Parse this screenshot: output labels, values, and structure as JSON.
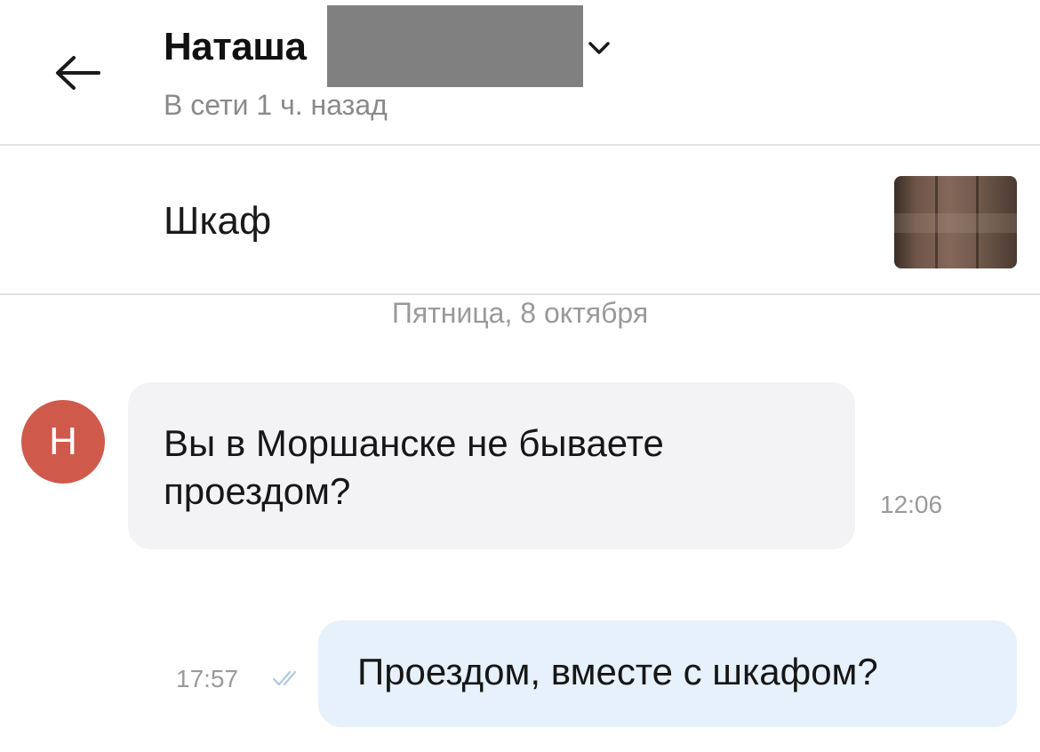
{
  "header": {
    "contact_name": "Наташа",
    "status": "В сети 1 ч. назад"
  },
  "listing": {
    "title": "Шкаф"
  },
  "chat": {
    "date_separator": "Пятница, 8 октября",
    "messages": [
      {
        "direction": "incoming",
        "avatar_letter": "Н",
        "text": "Вы в Моршанске не бываете проездом?",
        "time": "12:06"
      },
      {
        "direction": "outgoing",
        "text": "Проездом, вместе с шкафом?",
        "time": "17:57",
        "status_icon": "double-check-icon"
      }
    ]
  },
  "colors": {
    "avatar_bg": "#cf5a4c",
    "incoming_bubble": "#f3f3f5",
    "outgoing_bubble": "#e6f1fb",
    "read_ticks": "#a8c4e0",
    "redaction": "#808080"
  }
}
